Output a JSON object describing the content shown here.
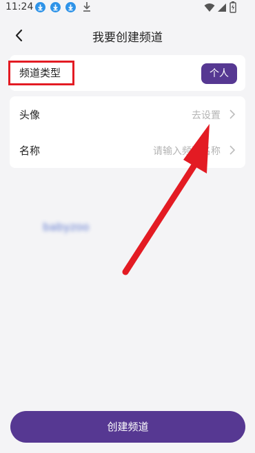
{
  "status_bar": {
    "time": "11:24",
    "icons": [
      "download-icon",
      "download-icon",
      "download-icon",
      "download-plain-icon",
      "wifi-icon",
      "signal-icon",
      "battery-icon"
    ]
  },
  "header": {
    "title": "我要创建频道"
  },
  "channel_type": {
    "label": "频道类型",
    "value": "个人"
  },
  "form": {
    "avatar": {
      "label": "头像",
      "value": "去设置"
    },
    "name": {
      "label": "名称",
      "placeholder": "请输入频道名称"
    }
  },
  "blurred_text": "babyzoo",
  "create_button": {
    "label": "创建频道"
  },
  "colors": {
    "primary": "#563892",
    "annotation": "#e31b23",
    "background": "#f4f4f6"
  }
}
